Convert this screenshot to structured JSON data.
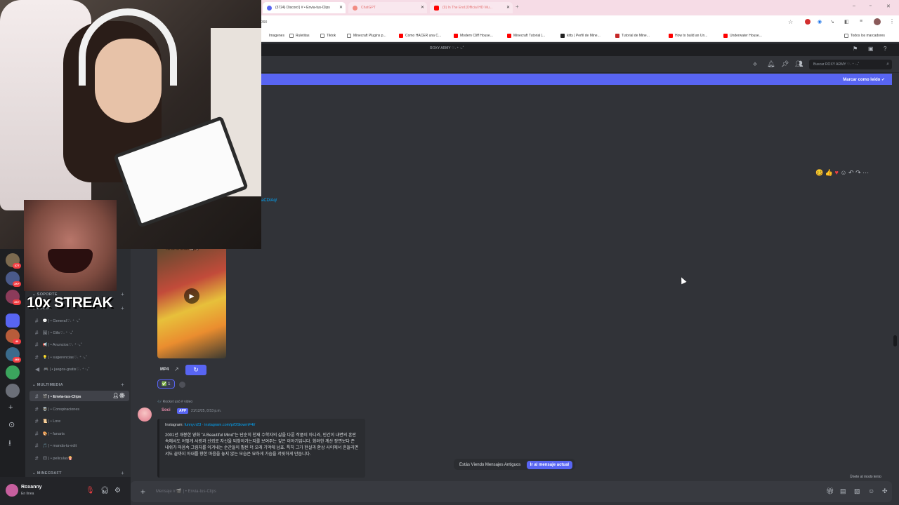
{
  "browser": {
    "tabs": [
      {
        "label": "(3724) Discord | # • Envia-tus-Clips",
        "fav": "#5865f2",
        "active": true
      },
      {
        "label": "ChatGPT",
        "fav": "#f28b82",
        "active": false
      },
      {
        "label": "(9) In The End [Official HD Mu...",
        "fav": "#ff0000",
        "active": false
      }
    ],
    "url": "390",
    "bookmarks": [
      "Imagenes",
      "Ruletitas",
      "Tiktok",
      "Minecraft Plugins p...",
      "Como HACER una C...",
      "Modern Cliff House...",
      "Minecraft Tutorial |...",
      "kitty | Perfil de Mine...",
      "Tutorial de Mine...",
      "How to build an Un...",
      "Underwater House...",
      "Todos los marcadores"
    ]
  },
  "overlay": {
    "streak": "10x STREAK"
  },
  "discord": {
    "server_title": "ROXY ARMY ♡˖ ⁺ ‧₊˚",
    "search_placeholder": "Buscar ROXY ARMY ♡˖ ⁺ ‧₊˚",
    "new_messages": {
      "mark_read": "Marcar como leído"
    },
    "rail_badges": [
      "377",
      "2K+",
      "2K+",
      "40",
      "469"
    ],
    "categories": [
      {
        "label": "SOPORTE"
      },
      {
        "label": "LOBBY"
      },
      {
        "label": "MULTIMEDIA"
      },
      {
        "label": "MINECRAFT"
      }
    ],
    "channels_lobby": [
      "💬 | • General♡˖ ⁺ ‧₊˚",
      "🖼 | • Gifs♡˖ ⁺ ‧₊˚",
      "📢 | • Anuncios♡˖ ⁺ ‧₊˚",
      "💡 | • sugerencias♡˖ ⁺ ‧₊˚",
      "🎮 | • juegos-gratis♡˖ ⁺ ‧₊˚"
    ],
    "channels_multimedia": [
      "🎬 | • Envia-tus-Clips",
      "👽 | • Conspiraciones",
      "📜 | • Lore",
      "🎨 | • fanarts",
      "🎵 | • manda-tu-edit",
      "🎞 | • peliculas🍿"
    ],
    "user": {
      "name": "Roxanny",
      "status": "En línea"
    },
    "chat": {
      "link_fragment": "aCDlAq/",
      "video_caption": "Ya tu lo chas (gal)",
      "mp4_label": "MP4",
      "reaction": {
        "emoji": "✅",
        "count": "1"
      },
      "reply_line": "🎶 Rocket usó # video",
      "bot_name": "Soci",
      "app_badge": "APP",
      "bot_time": "21/12/25, 8:53 p.m.",
      "embed_ig_label": "Instagram:",
      "embed_ig_user": "funny.n23",
      "embed_ig_link": "· instagram.com/p/DSlowmF4t/",
      "embed_body": "2001년 개봉한 영화 \"A Beautiful Mind\"는 단순히 천재 수학자의 삶을 다룬 작품이 아니라, 인간이 내면의 혼란 속에서도 어떻게 사랑과 신뢰로 자신을 되찾아가는지를 보여주는 깊은 이야기입니다. 화려한 계산 장면보다 존 내쉬가 마음속 그림자를 이겨내는 순간들이 훨씬 더 오래 기억에 남죠. 특히 그가 현실과 환상 사이에서 흔들리면서도 끝까지 아내를 향한 마음을 놓지 않는 모습은 묘하게 가슴을 저릿하게 만듭니다."
    },
    "old_messages": {
      "text": "Estás Viendo Mensajes Antiguos",
      "jump": "Ir al mensaje actual"
    },
    "focus_mode": "Únete al modo lento",
    "composer_placeholder": "Mensaje # 🎬 | • Envia-tus-Clips"
  }
}
